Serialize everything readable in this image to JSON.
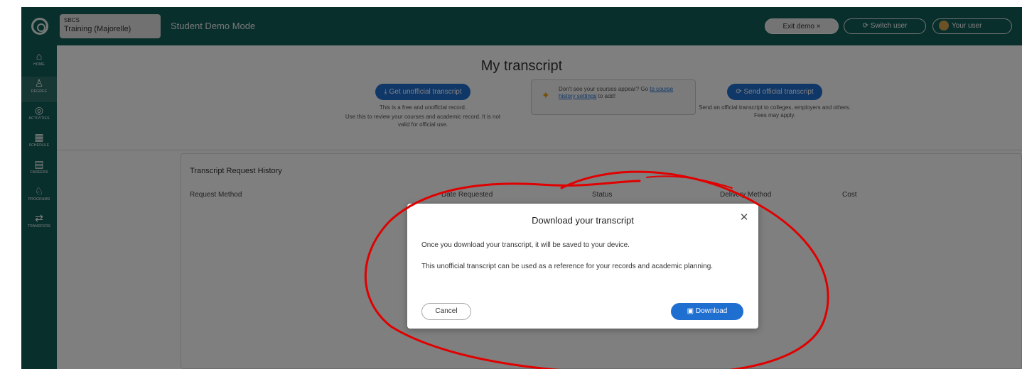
{
  "topbar": {
    "school_small": "SBCS",
    "school_name": "Training (Majorelle)",
    "demo_label": "Student Demo Mode",
    "exit_label": "Exit demo ×",
    "switch_label": "⟳ Switch user",
    "user_label": "Your user"
  },
  "sidebar": {
    "items": [
      {
        "glyph": "⌂",
        "label": "HOME"
      },
      {
        "glyph": "♙",
        "label": "DEGREE"
      },
      {
        "glyph": "◎",
        "label": "ACTIVITIES"
      },
      {
        "glyph": "▦",
        "label": "SCHEDULE"
      },
      {
        "glyph": "▤",
        "label": "CAREERS"
      },
      {
        "glyph": "♘",
        "label": "PROGRAMS"
      },
      {
        "glyph": "⇄",
        "label": "TRANSFERS"
      }
    ]
  },
  "page": {
    "title": "My transcript",
    "unofficial": {
      "button": "⤓ Get unofficial transcript",
      "note1": "This is a free and unofficial record.",
      "note2": "Use this to review your courses and academic record. It is not valid for official use."
    },
    "tip": {
      "text": "Don't see your courses appear? Go",
      "link": "to course history settings",
      "text_after": "to add!"
    },
    "official": {
      "button": "⟳ Send official transcript",
      "note": "Send an official transcript to colleges, employers and others. Fees may apply."
    },
    "panel_title": "Transcript Request History",
    "columns": [
      "Request Method",
      "Date Requested",
      "Status",
      "Delivery Method",
      "Cost"
    ]
  },
  "modal": {
    "title": "Download your transcript",
    "p1": "Once you download your transcript, it will be saved to your device.",
    "p2": "This unofficial transcript can be used as a reference for your records and academic planning.",
    "cancel": "Cancel",
    "download": "Download"
  },
  "colors": {
    "brand_teal": "#115e58",
    "primary_blue": "#1f6fd1",
    "annotation_red": "#e00000"
  }
}
